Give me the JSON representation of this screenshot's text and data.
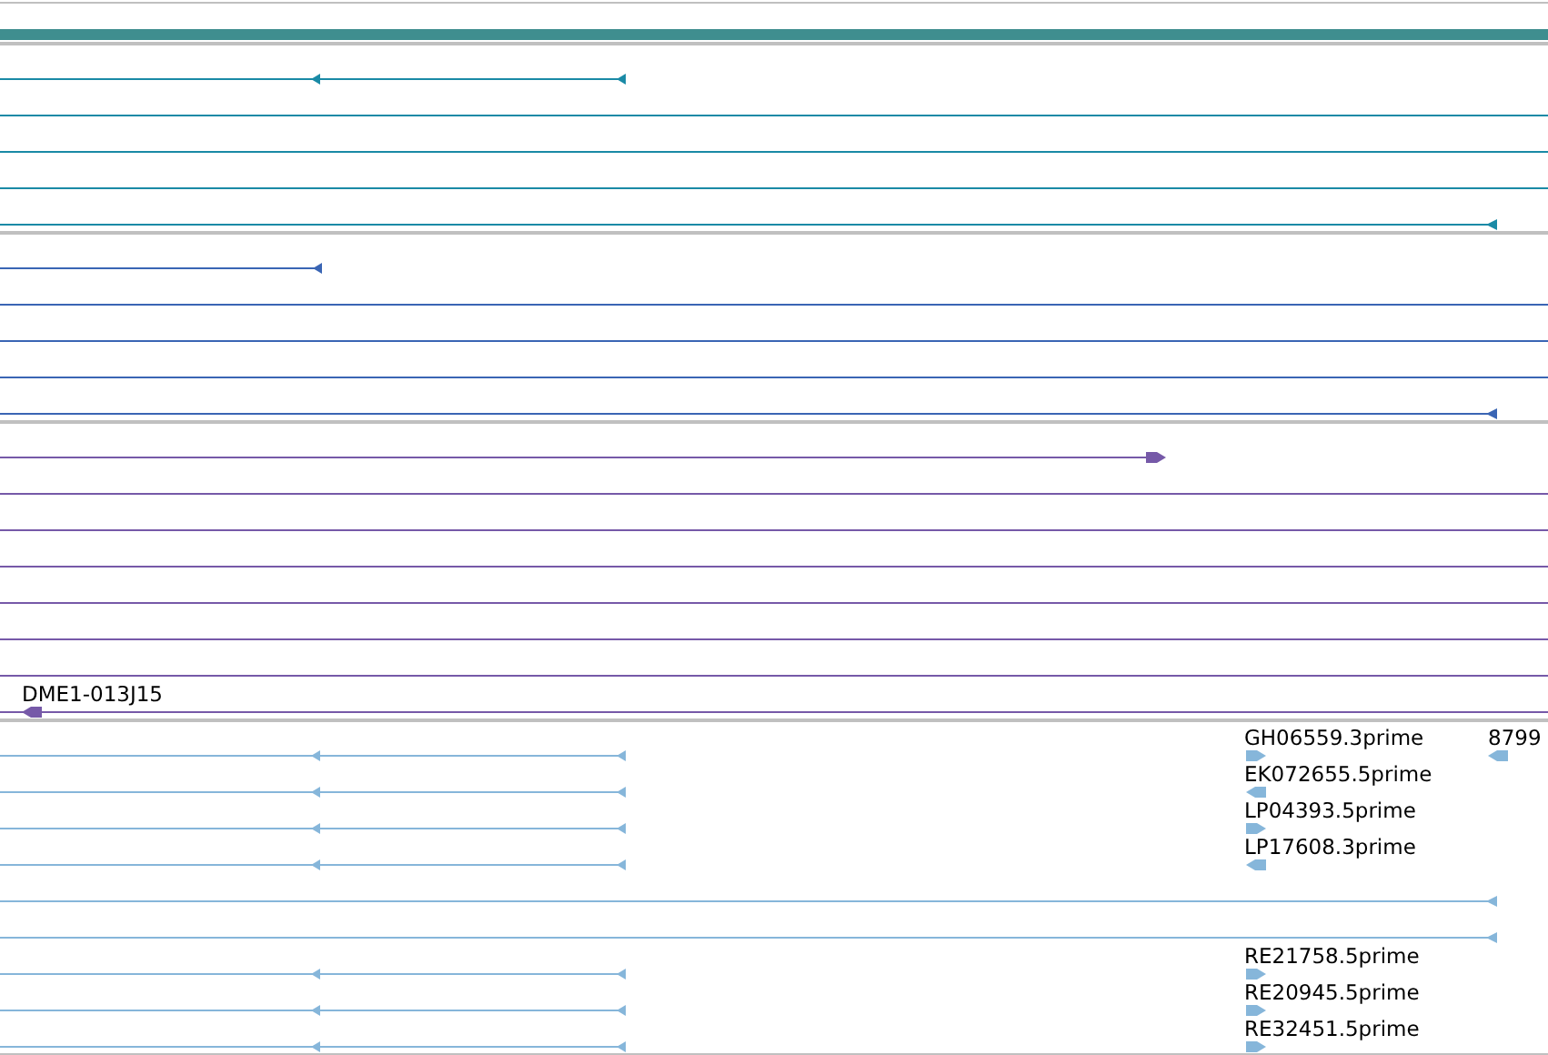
{
  "ruler": {
    "color": "#3f8e8f"
  },
  "tracks": [
    {
      "color": "#1a8aa6",
      "rows": [
        {
          "kind": "split"
        },
        {
          "kind": "full"
        },
        {
          "kind": "full"
        },
        {
          "kind": "full"
        },
        {
          "kind": "full-tail"
        }
      ]
    },
    {
      "color": "#3a65b4",
      "rows": [
        {
          "kind": "short"
        },
        {
          "kind": "full"
        },
        {
          "kind": "full"
        },
        {
          "kind": "full"
        },
        {
          "kind": "full-tail"
        }
      ]
    },
    {
      "color": "#7659a8",
      "rows": [
        {
          "kind": "forward"
        },
        {
          "kind": "full"
        },
        {
          "kind": "full"
        },
        {
          "kind": "full"
        },
        {
          "kind": "full"
        },
        {
          "kind": "full"
        },
        {
          "kind": "full"
        },
        {
          "kind": "full",
          "features": [
            {
              "kind": "left",
              "label": "DME1-013J15",
              "reverse": true
            }
          ]
        }
      ]
    },
    {
      "color": "#86b6da",
      "rows": [
        {
          "kind": "split",
          "features": [
            {
              "kind": "mid",
              "label": "GH06559.3prime",
              "reverse": false
            },
            {
              "kind": "end",
              "label": "8799",
              "reverse": true
            }
          ]
        },
        {
          "kind": "split",
          "features": [
            {
              "kind": "mid",
              "label": "EK072655.5prime",
              "reverse": true
            }
          ]
        },
        {
          "kind": "split",
          "features": [
            {
              "kind": "mid",
              "label": "LP04393.5prime",
              "reverse": false
            }
          ]
        },
        {
          "kind": "split",
          "features": [
            {
              "kind": "mid",
              "label": "LP17608.3prime",
              "reverse": true
            }
          ]
        },
        {
          "kind": "full-tail"
        },
        {
          "kind": "full-tail"
        },
        {
          "kind": "split",
          "features": [
            {
              "kind": "mid",
              "label": "RE21758.5prime",
              "reverse": false
            }
          ]
        },
        {
          "kind": "split",
          "features": [
            {
              "kind": "mid",
              "label": "RE20945.5prime",
              "reverse": false
            }
          ]
        },
        {
          "kind": "split",
          "features": [
            {
              "kind": "mid",
              "label": "RE32451.5prime",
              "reverse": false
            }
          ]
        }
      ]
    }
  ]
}
